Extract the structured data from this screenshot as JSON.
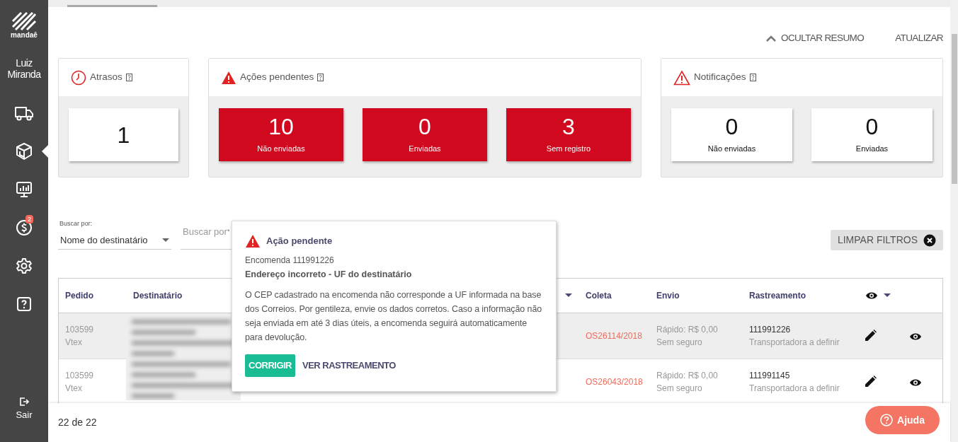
{
  "sidebar": {
    "logo_text": "mandaê",
    "user": "Luiz Miranda",
    "items": [
      {
        "kind": "truck",
        "selected": false
      },
      {
        "kind": "box",
        "selected": true
      },
      {
        "kind": "monitor",
        "selected": false
      },
      {
        "kind": "money",
        "selected": false,
        "badge": "2"
      },
      {
        "kind": "gear",
        "selected": false
      },
      {
        "kind": "help",
        "selected": false
      }
    ],
    "logout": "Sair"
  },
  "top_actions": [
    {
      "label": "OCULTAR RESUMO",
      "kind": "collapse"
    },
    {
      "label": "ATUALIZAR",
      "kind": "plain"
    }
  ],
  "summary": [
    {
      "title": "Atrasos",
      "tiles": [
        {
          "value": "1",
          "kind": "plain"
        }
      ]
    },
    {
      "title": "Ações pendentes",
      "tiles": [
        {
          "value": "10",
          "label": "Não enviadas",
          "kind": "alert"
        },
        {
          "value": "0",
          "label": "Enviadas",
          "kind": "alert"
        },
        {
          "value": "3",
          "label": "Sem registro",
          "kind": "alert"
        }
      ]
    },
    {
      "title": "Notificações",
      "tiles": [
        {
          "value": "0",
          "label": "Não enviadas",
          "kind": "plain"
        },
        {
          "value": "0",
          "label": "Enviadas",
          "kind": "plain"
        }
      ]
    }
  ],
  "filters": {
    "caption": "Buscar por:",
    "select": "Nome do destinatário",
    "search_placeholder": "Buscar por",
    "required_mark": "*",
    "clear_button": "LIMPAR FILTROS"
  },
  "table": {
    "columns": [
      {
        "label": "Pedido",
        "dropdown": false
      },
      {
        "label": "Destinatário",
        "dropdown": false
      },
      {
        "dropdown": true
      },
      {
        "label": "Coleta",
        "dropdown": false
      },
      {
        "label": "Envio",
        "dropdown": false
      },
      {
        "label": "Rastreamento",
        "dropdown": false
      },
      {
        "kind": "visibility",
        "dropdown": true
      }
    ],
    "rows": [
      {
        "selected": true,
        "order": [
          "103599",
          "Vtex"
        ],
        "pickup": "OS26114/2018",
        "shipping": [
          "Rápido: R$ 0,00",
          "Sem seguro"
        ],
        "tracking": "111991226",
        "carrier": "Transportadora a definir"
      },
      {
        "selected": false,
        "order": [
          "103599",
          "Vtex"
        ],
        "pickup": "OS26043/2018",
        "shipping": [
          "Rápido: R$ 0,00",
          "Sem seguro"
        ],
        "tracking": "111991145",
        "carrier": "Transportadora a definir"
      }
    ]
  },
  "pager": "22 de 22",
  "help_button": "Ajuda",
  "popover": {
    "title": "Ação pendente",
    "subtitle": "Encomenda 111991226",
    "heading": "Endereço incorreto - UF do destinatário",
    "body": "O CEP cadastrado na encomenda não corresponde a UF informada na base dos Correios. Por gentileza, envie os dados corretos. Caso a informação não seja enviada em até 3 dias úteis, a encomenda seguirá automaticamente para devolução.",
    "actions": [
      {
        "label": "CORRIGIR",
        "kind": "primary"
      },
      {
        "label": "VER RASTREAMENTO",
        "kind": "link"
      }
    ]
  }
}
